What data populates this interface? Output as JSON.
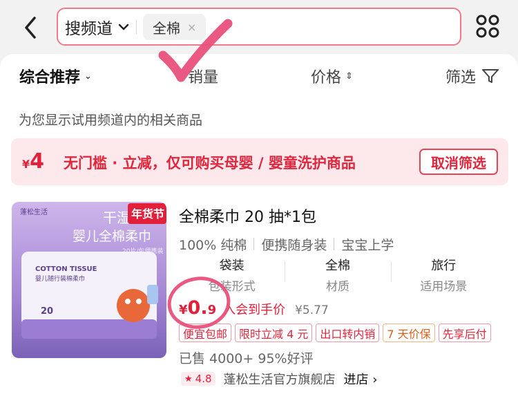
{
  "header": {
    "channel_label": "搜频道",
    "search_tag": "全棉",
    "search_tag_close": "×"
  },
  "sortbar": {
    "items": [
      {
        "label": "综合推荐",
        "indicator": "⌄",
        "active": true
      },
      {
        "label": "销量",
        "indicator": ""
      },
      {
        "label": "价格",
        "indicator": "⇕"
      },
      {
        "label": "筛选",
        "indicator": "filter-icon"
      }
    ]
  },
  "notice": "为您显示试用频道内的相关商品",
  "coupon": {
    "currency": "¥",
    "amount": "4",
    "text": "无门槛 · 立减，仅可购买母婴 / 婴童洗护商品",
    "button_label": "取消筛选"
  },
  "product": {
    "image": {
      "brand": "蓬松生活",
      "headline_1": "干湿",
      "headline_2": "婴儿全棉柔巾",
      "spec": "20片/包便携装",
      "festival_badge": "年货节",
      "pack_en": "COTTON TISSUE",
      "pack_cn": "婴儿随行装棉柔巾",
      "pack_count": "20"
    },
    "title": "全棉柔巾 20 抽*1包",
    "features": [
      "100% 纯棉",
      "便携随身装",
      "宝宝上学"
    ],
    "attributes": [
      {
        "value": "袋装",
        "key": "包装形式"
      },
      {
        "value": "全棉",
        "key": "材质"
      },
      {
        "value": "旅行",
        "key": "适用场景"
      }
    ],
    "price": {
      "currency": "¥",
      "integer": "0.",
      "decimal": "9",
      "label": "入会到手价",
      "original": "¥5.77"
    },
    "badges": [
      {
        "text": "便宜包邮",
        "style": "red"
      },
      {
        "text": "限时立减 4 元",
        "style": "red"
      },
      {
        "text": "出口转内销",
        "style": "red"
      },
      {
        "text": "7 天价保",
        "style": "orange"
      },
      {
        "text": "先享后付",
        "style": "red"
      }
    ],
    "sales": "已售 4000+  95%好评",
    "shop": {
      "rating": "4.8",
      "name": "蓬松生活官方旗舰店",
      "enter_label": "进店 ›"
    }
  },
  "colors": {
    "accent": "#e3203a",
    "annotation": "#e8507a"
  }
}
